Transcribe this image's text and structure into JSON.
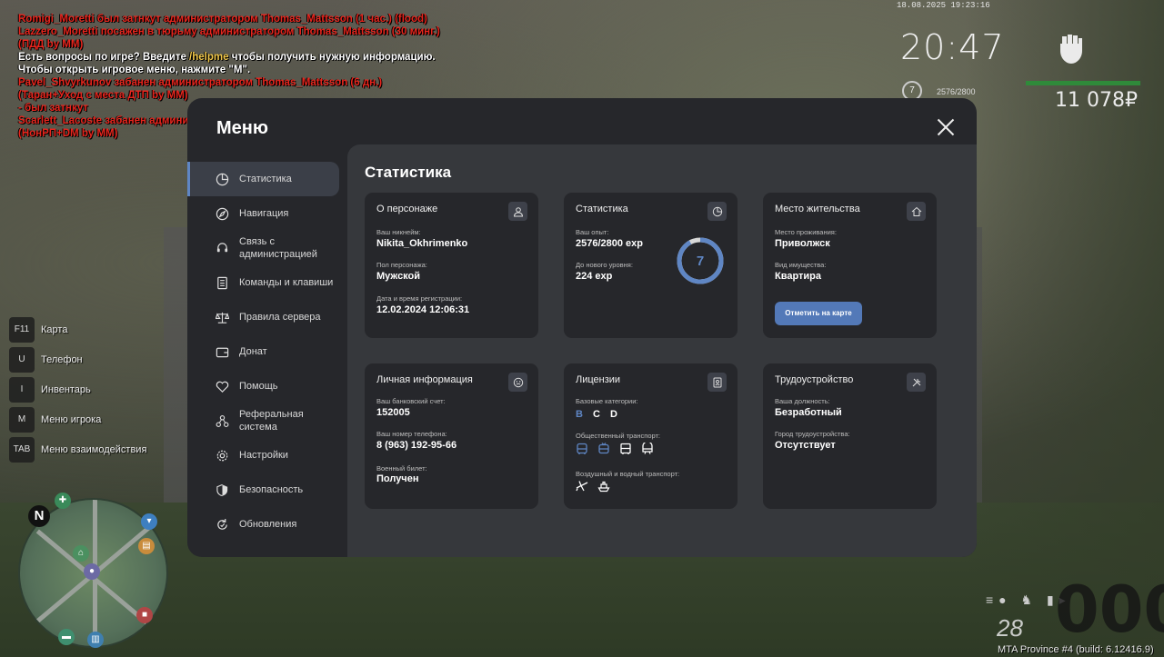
{
  "chat": [
    {
      "color": "red",
      "text": "Romigi_Moretti был затнкут администратором Thomas_Mattsson (1 час.) (flood)"
    },
    {
      "color": "red",
      "text": "Lazzero_Moretti посажен в тюрьму администратором Thomas_Mattsson (30 минг.) (ПДД by MM)"
    },
    {
      "color": "white",
      "pre": "Есть вопросы по игре? Введите ",
      "hl": "/helpme",
      "post": " чтобы получить нужную информацию."
    },
    {
      "color": "white",
      "text": "Чтобы открыть игровое меню, нажмите \"M\"."
    },
    {
      "color": "red",
      "text": "Pavel_Shvyrkunov забанен администратором Thomas_Mattsson (6 дн.) (Таран+Уход с места ДТП by MM)"
    },
    {
      "color": "red",
      "text": "- был затнкут"
    },
    {
      "color": "red",
      "text": "Scarlett_Lacoste забанен администратором Gerald_Schwarzenegger (5 дн.) (НонРП+DM by MM)"
    }
  ],
  "hud": {
    "datetime": "18.08.2025 19:23:16",
    "time": "20:47",
    "level": "7",
    "exp": "2576/2800",
    "money": "11 078₽"
  },
  "hotkeys": [
    {
      "key": "F11",
      "label": "Карта"
    },
    {
      "key": "U",
      "label": "Телефон"
    },
    {
      "key": "I",
      "label": "Инвентарь"
    },
    {
      "key": "M",
      "label": "Меню игрока"
    },
    {
      "key": "TAB",
      "label": "Меню взаимодействия"
    }
  ],
  "minimap": {
    "north": "N"
  },
  "speedometer": {
    "speed": "000",
    "fuel": "28"
  },
  "build": "MTA Province #4 (build: 6.12416.9)",
  "menu": {
    "title": "Меню",
    "nav": [
      {
        "label": "Статистика",
        "icon": "chart-icon",
        "active": true
      },
      {
        "label": "Навигация",
        "icon": "compass-icon"
      },
      {
        "label": "Связь с администрацией",
        "icon": "headset-icon"
      },
      {
        "label": "Команды и клавиши",
        "icon": "keyboard-icon"
      },
      {
        "label": "Правила сервера",
        "icon": "scales-icon"
      },
      {
        "label": "Донат",
        "icon": "wallet-icon"
      },
      {
        "label": "Помощь",
        "icon": "handshake-icon"
      },
      {
        "label": "Реферальная система",
        "icon": "referral-icon"
      },
      {
        "label": "Настройки",
        "icon": "gear-icon"
      },
      {
        "label": "Безопасность",
        "icon": "shield-icon"
      },
      {
        "label": "Обновления",
        "icon": "refresh-icon"
      }
    ],
    "content_title": "Статистика",
    "cards": {
      "character": {
        "title": "О персонаже",
        "nickname_label": "Ваш никнейм:",
        "nickname": "Nikita_Okhrimenko",
        "gender_label": "Пол персонажа:",
        "gender": "Мужской",
        "reg_label": "Дата и время регистрации:",
        "reg": "12.02.2024 12:06:31"
      },
      "stats": {
        "title": "Статистика",
        "exp_label": "Ваш опыт:",
        "exp": "2576/2800 exp",
        "next_label": "До нового уровня:",
        "next": "224 exp",
        "level": "7",
        "progress": 0.92
      },
      "residence": {
        "title": "Место жительства",
        "place_label": "Место проживания:",
        "place": "Приволжск",
        "property_label": "Вид имущества:",
        "property": "Квартира",
        "button": "Отметить на карте"
      },
      "personal": {
        "title": "Личная информация",
        "bank_label": "Ваш банковский счет:",
        "bank": "152005",
        "phone_label": "Ваш номер телефона:",
        "phone": "8 (963) 192-95-66",
        "military_label": "Военный билет:",
        "military": "Получен"
      },
      "licenses": {
        "title": "Лицензии",
        "base_label": "Базовые категории:",
        "categories": [
          "B",
          "C",
          "D"
        ],
        "public_label": "Общественный транспорт:",
        "air_label": "Воздушный и водный транспорт:"
      },
      "employment": {
        "title": "Трудоустройство",
        "position_label": "Ваша должность:",
        "position": "Безработный",
        "city_label": "Город трудоустройства:",
        "city": "Отсутствует"
      }
    }
  },
  "colors": {
    "accent": "#5f86c4",
    "card_bg": "#26272b",
    "content_bg": "#36383c",
    "chat_red": "#e8261e"
  }
}
